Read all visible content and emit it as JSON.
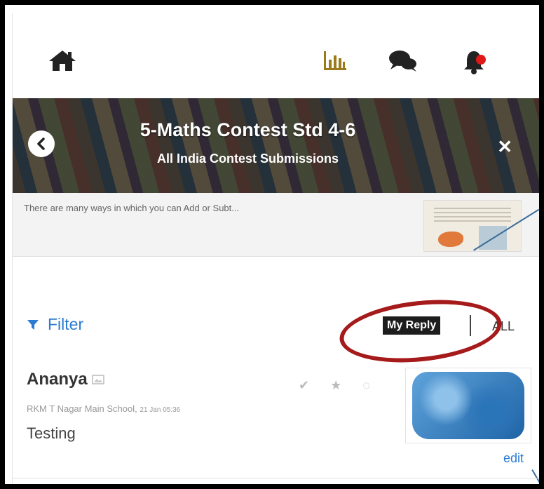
{
  "banner": {
    "title": "5-Maths Contest Std 4-6",
    "subtitle": "All India Contest Submissions"
  },
  "description": {
    "text": "There are many ways in which you can Add or Subt..."
  },
  "filter": {
    "label": "Filter",
    "my_reply": "My Reply",
    "all": "ALL"
  },
  "post": {
    "name": "Ananya",
    "school": "RKM T Nagar Main School,",
    "date": "21 Jan 05:36",
    "text": "Testing",
    "edit": "edit"
  },
  "icons": {
    "home": "home-icon",
    "chart": "bar-chart-icon",
    "chat": "chat-icon",
    "bell": "bell-icon",
    "back": "back-icon",
    "close": "close-icon",
    "filter": "filter-icon"
  },
  "colors": {
    "accent": "#2b7bd3",
    "annotation": "#a51a1a",
    "notification": "#e11818"
  }
}
